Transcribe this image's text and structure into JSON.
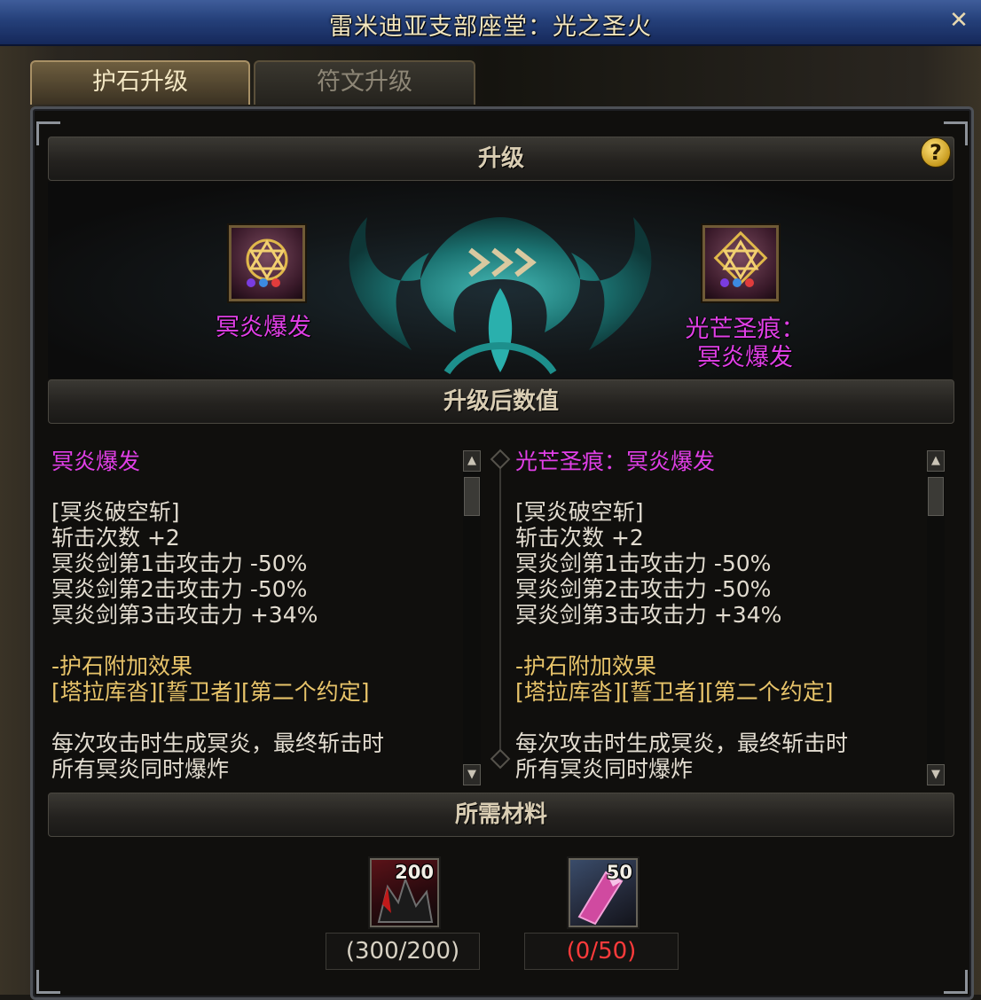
{
  "window": {
    "title": "雷米迪亚支部座堂：光之圣火",
    "close_glyph": "✕"
  },
  "tabs": [
    {
      "label": "护石升级",
      "active": true
    },
    {
      "label": "符文升级",
      "active": false
    }
  ],
  "sections": {
    "upgrade": "升级",
    "after_values": "升级后数值",
    "materials": "所需材料"
  },
  "help_glyph": "?",
  "upgrade": {
    "from_name": "冥炎爆发",
    "to_name_line1": "光芒圣痕：",
    "to_name_line2": "冥炎爆发"
  },
  "stats_left": {
    "name": "冥炎爆发",
    "lines": [
      "[冥炎破空斩]",
      "斩击次数 +2",
      "冥炎剑第1击攻击力 -50%",
      "冥炎剑第2击攻击力 -50%",
      "冥炎剑第3击攻击力 +34%"
    ],
    "bonus_title": "-护石附加效果",
    "bonus_set": "[塔拉库沓][誓卫者][第二个约定]",
    "desc_lines": [
      "每次攻击时生成冥炎，最终斩击时",
      "所有冥炎同时爆炸"
    ]
  },
  "stats_right": {
    "name": "光芒圣痕：冥炎爆发",
    "lines": [
      "[冥炎破空斩]",
      "斩击次数 +2",
      "冥炎剑第1击攻击力 -50%",
      "冥炎剑第2击攻击力 -50%",
      "冥炎剑第3击攻击力 +34%"
    ],
    "bonus_title": "-护石附加效果",
    "bonus_set": "[塔拉库沓][誓卫者][第二个约定]",
    "desc_lines": [
      "每次攻击时生成冥炎，最终斩击时",
      "所有冥炎同时爆炸"
    ]
  },
  "materials": [
    {
      "count": "200",
      "progress": "(300/200)",
      "color": "#d8d2c4"
    },
    {
      "count": "50",
      "progress": "(0/50)",
      "color": "#ff3b3b"
    }
  ],
  "colors": {
    "accent_purple": "#e03fe6",
    "gold_text": "#e8c46a",
    "insufficient": "#ff3b3b"
  }
}
